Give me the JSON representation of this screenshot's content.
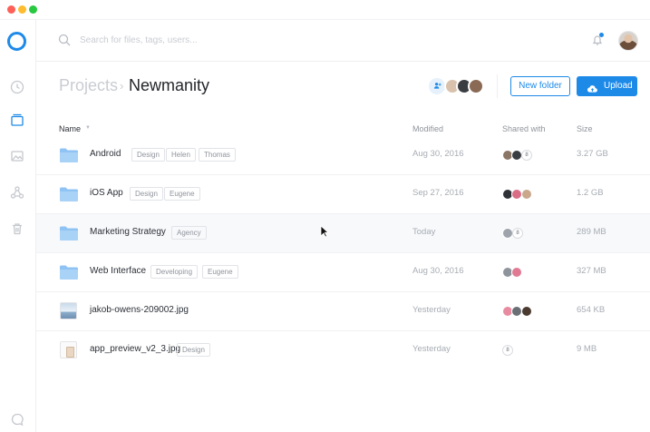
{
  "search": {
    "placeholder": "Search for files, tags, users..."
  },
  "breadcrumb": {
    "parent": "Projects",
    "separator": "›",
    "current": "Newmanity"
  },
  "actions": {
    "new_folder": "New folder",
    "upload": "Upload"
  },
  "table": {
    "headers": {
      "name": "Name",
      "modified": "Modified",
      "shared": "Shared with",
      "size": "Size"
    },
    "rows": [
      {
        "name": "Android",
        "tags": [
          "Design",
          "Helen",
          "Thomas"
        ],
        "modified": "Aug 30, 2016",
        "size": "3.27 GB",
        "more": "8"
      },
      {
        "name": "iOS App",
        "tags": [
          "Design",
          "Eugene"
        ],
        "modified": "Sep 27, 2016",
        "size": "1.2 GB",
        "more": ""
      },
      {
        "name": "Marketing Strategy",
        "tags": [
          "Agency"
        ],
        "modified": "Today",
        "size": "289 MB",
        "more": "8"
      },
      {
        "name": "Web Interface",
        "tags": [
          "Developing",
          "Eugene"
        ],
        "modified": "Aug 30, 2016",
        "size": "327 MB",
        "more": ""
      },
      {
        "name": "jakob-owens-209002.jpg",
        "tags": [],
        "modified": "Yesterday",
        "size": "654 KB",
        "more": ""
      },
      {
        "name": "app_preview_v2_3.jpg",
        "tags": [
          "Design"
        ],
        "modified": "Yesterday",
        "size": "9 MB",
        "more": "8"
      }
    ]
  },
  "colors": {
    "accent": "#1e8ae8",
    "folder": "#8fc3f4"
  }
}
